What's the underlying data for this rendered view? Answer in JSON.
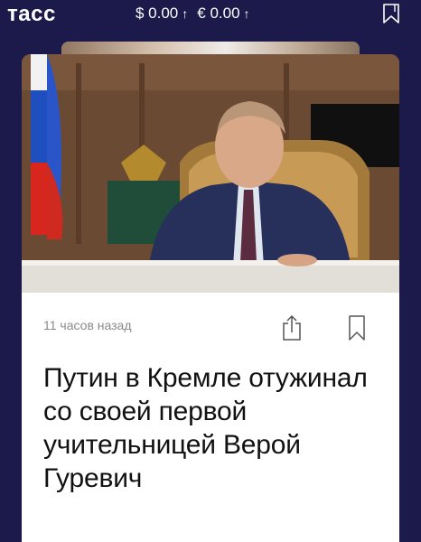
{
  "header": {
    "logo": "тасс",
    "usd_rate": "$ 0.00",
    "eur_rate": "€ 0.00",
    "arrow": "↑",
    "bookmark_icon": "bookmark-icon"
  },
  "article": {
    "time_ago": "11 часов назад",
    "headline": "Путин в Кремле отужинал со своей первой учительницей Верой Гуревич",
    "share_icon": "share-icon",
    "save_icon": "bookmark-icon"
  },
  "colors": {
    "background": "#1b1a4a",
    "card": "#ffffff",
    "meta_text": "#8a8a8a",
    "headline_text": "#111111"
  }
}
